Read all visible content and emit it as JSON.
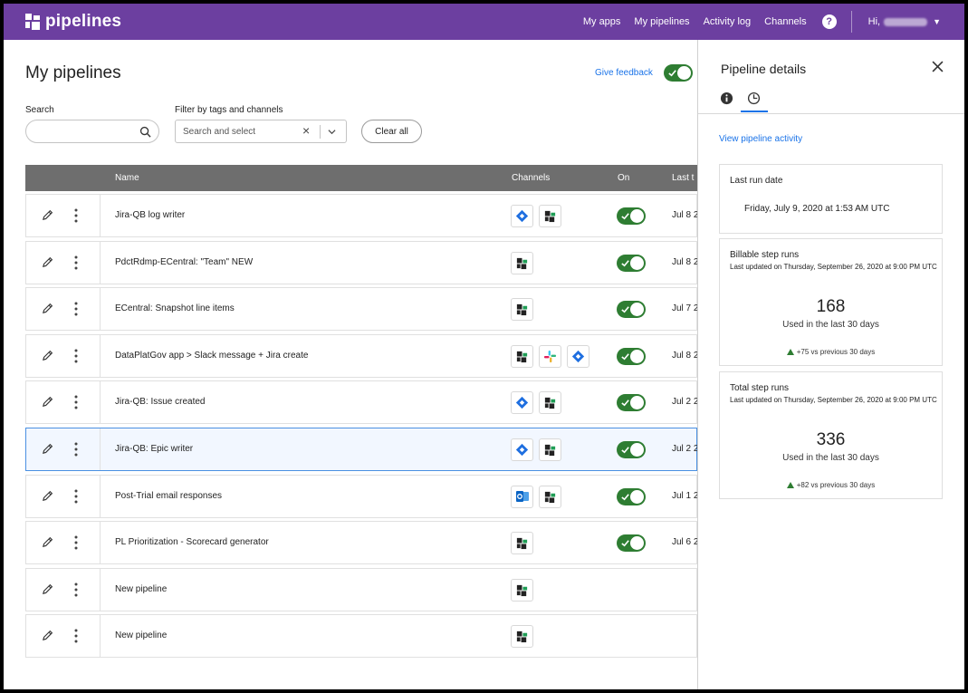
{
  "app": {
    "brand": "pipelines",
    "nav": [
      "My apps",
      "My pipelines",
      "Activity log",
      "Channels"
    ],
    "help_label": "?",
    "greeting": "Hi,",
    "colors": {
      "header": "#6c3fa0",
      "toggle_on": "#2e7d32",
      "link": "#1a73e8"
    }
  },
  "main": {
    "title": "My pipelines",
    "feedback_label": "Give feedback",
    "search": {
      "label": "Search",
      "value": "",
      "placeholder": ""
    },
    "filter": {
      "label": "Filter by tags and channels",
      "placeholder": "Search and select",
      "clear_glyph": "×"
    },
    "clear_all": "Clear all",
    "columns": {
      "name": "Name",
      "channels": "Channels",
      "on": "On",
      "last": "Last t"
    }
  },
  "rows": [
    {
      "name": "Jira-QB log writer",
      "channels": [
        "jira-icon",
        "connector-icon"
      ],
      "on": true,
      "last": "Jul 8 2",
      "selected": false
    },
    {
      "name": "PdctRdmp-ECentral: \"Team\" NEW",
      "channels": [
        "connector-icon"
      ],
      "on": true,
      "last": "Jul 8 2",
      "selected": false
    },
    {
      "name": "ECentral: Snapshot line items",
      "channels": [
        "connector-icon"
      ],
      "on": true,
      "last": "Jul 7 2",
      "selected": false
    },
    {
      "name": "DataPlatGov app > Slack message + Jira create",
      "channels": [
        "connector-icon",
        "slack-icon",
        "jira-icon"
      ],
      "on": true,
      "last": "Jul 8 2",
      "selected": false
    },
    {
      "name": "Jira-QB: Issue created",
      "channels": [
        "jira-icon",
        "connector-icon"
      ],
      "on": true,
      "last": "Jul 2 2",
      "selected": false
    },
    {
      "name": "Jira-QB: Epic writer",
      "channels": [
        "jira-icon",
        "connector-icon"
      ],
      "on": true,
      "last": "Jul 2 2",
      "selected": true
    },
    {
      "name": "Post-Trial email responses",
      "channels": [
        "outlook-icon",
        "connector-icon"
      ],
      "on": true,
      "last": "Jul 1 2",
      "selected": false
    },
    {
      "name": "PL Prioritization - Scorecard generator",
      "channels": [
        "connector-icon"
      ],
      "on": true,
      "last": "Jul 6 2",
      "selected": false
    },
    {
      "name": "New pipeline",
      "channels": [
        "connector-icon"
      ],
      "on": false,
      "last": "",
      "selected": false
    },
    {
      "name": "New pipeline",
      "channels": [
        "connector-icon"
      ],
      "on": false,
      "last": "",
      "selected": false
    }
  ],
  "panel": {
    "title": "Pipeline details",
    "activity_link": "View pipeline activity",
    "last_run": {
      "title": "Last run date",
      "value": "Friday, July 9, 2020 at 1:53 AM UTC"
    },
    "billable": {
      "title": "Billable step runs",
      "updated": "Last updated on Thursday, September 26, 2020 at 9:00 PM UTC",
      "value": "168",
      "sub": "Used in the last 30 days",
      "delta": "+75 vs previous 30 days"
    },
    "total": {
      "title": "Total step runs",
      "updated": "Last updated on Thursday, September 26, 2020 at 9:00 PM UTC",
      "value": "336",
      "sub": "Used in the last 30 days",
      "delta": "+82 vs previous 30 days"
    }
  }
}
